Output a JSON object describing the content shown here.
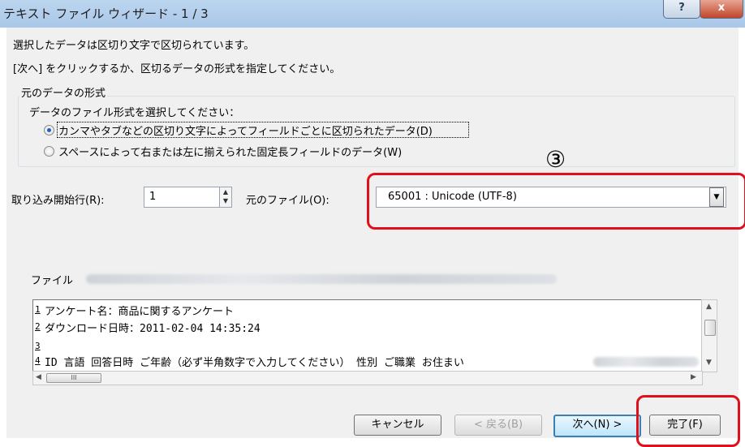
{
  "window": {
    "title": "テキスト ファイル ウィザード - 1 / 3",
    "help_label": "?",
    "close_label": "x"
  },
  "intro": {
    "line1": "選択したデータは区切り文字で区切られています。",
    "line2": "[次へ] をクリックするか、区切るデータの形式を指定してください。"
  },
  "format_group": {
    "title": "元のデータの形式",
    "prompt": "データのファイル形式を選択してください：",
    "options": [
      {
        "label": "カンマやタブなどの区切り文字によってフィールドごとに区切られたデータ(D)",
        "checked": true
      },
      {
        "label": "スペースによって右または左に揃えられた固定長フィールドのデータ(W)",
        "checked": false
      }
    ]
  },
  "annotation": {
    "marker": "③",
    "color": "#e0101a"
  },
  "start_row": {
    "label": "取り込み開始行(R):",
    "value": "1"
  },
  "origin": {
    "label": "元のファイル(O):",
    "selected": "65001 : Unicode (UTF-8)"
  },
  "preview": {
    "file_label": "ファイル",
    "rows": [
      {
        "num": "1",
        "text": "アンケート名：商品に関するアンケート"
      },
      {
        "num": "2",
        "text": "ダウンロード日時：2011-02-04 14:35:24"
      },
      {
        "num": "3",
        "text": ""
      },
      {
        "num": "4",
        "text": "ID 言語 回答日時 ご年齢（必ず半角数字で入力してください） 性別 ご職業 お住まい"
      }
    ],
    "hscroll_thumb": "III"
  },
  "buttons": {
    "cancel": "キャンセル",
    "back": "< 戻る(B)",
    "next": "次へ(N) >",
    "finish": "完了(F)"
  }
}
